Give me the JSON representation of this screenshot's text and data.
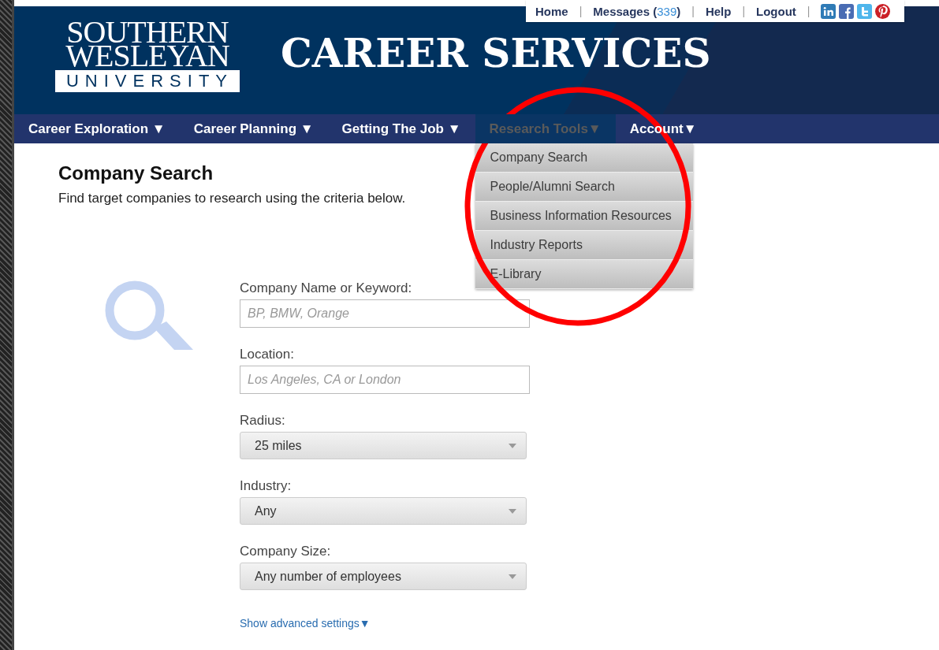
{
  "top_links": [
    {
      "label": "Home",
      "separator": "|"
    },
    {
      "label": "Messages (",
      "count": "339",
      "suffix": ")",
      "separator": "|"
    },
    {
      "label": "Help",
      "separator": "|"
    },
    {
      "label": "Logout",
      "separator": "|"
    }
  ],
  "logo": {
    "line_1": "SOUTHERN",
    "line_2": "WESLEYAN",
    "line_3": "UNIVERSITY"
  },
  "site_title": "CAREER SERVICES",
  "nav": [
    {
      "label": "Career Exploration ▼",
      "selected": false
    },
    {
      "label": "Career Planning ▼",
      "selected": false
    },
    {
      "label": "Getting The Job ▼",
      "selected": false
    },
    {
      "label": "Research Tools▼",
      "selected": true
    },
    {
      "label": "Account▼",
      "selected": false
    }
  ],
  "dropdown": [
    "Company Search",
    "People/Alumni Search",
    "Business Information Resources",
    "Industry Reports",
    "E-Library"
  ],
  "heading": "Company Search",
  "intro": "Find target companies to research using the criteria below.",
  "fields": [
    {
      "kind": "text",
      "label": "Company Name or Keyword:",
      "placeholder": "BP, BMW, Orange"
    },
    {
      "kind": "text",
      "label": "Location:",
      "placeholder": "Los Angeles, CA or London"
    },
    {
      "kind": "select",
      "label": "Radius:",
      "value": "25 miles"
    },
    {
      "kind": "select",
      "label": "Industry:",
      "value": "Any"
    },
    {
      "kind": "select",
      "label": "Company Size:",
      "value": "Any number of employees"
    }
  ],
  "advanced_link": "Show advanced settings▼"
}
